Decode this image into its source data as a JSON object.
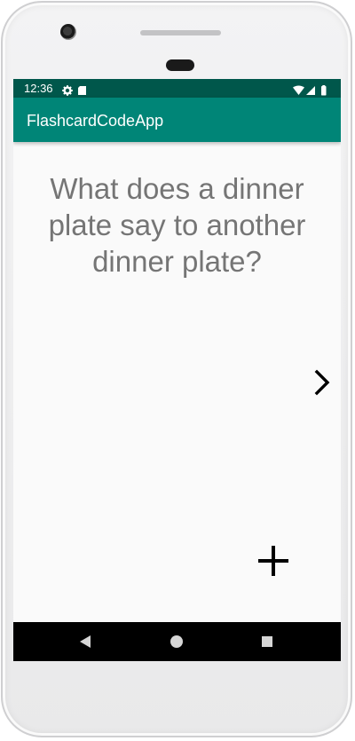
{
  "status_bar": {
    "time": "12:36",
    "left_icons": [
      "gear-icon",
      "sd-card-icon"
    ],
    "right_icons": [
      "wifi-icon",
      "signal-icon",
      "battery-icon"
    ],
    "color": "#00574b"
  },
  "app_bar": {
    "title": "FlashcardCodeApp",
    "color": "#008577"
  },
  "card": {
    "question": "What does a dinner plate say to another dinner plate?",
    "text_color": "#757575"
  },
  "actions": {
    "next_icon": "chevron-right-icon",
    "add_icon": "plus-icon"
  },
  "nav_bar": {
    "icons": [
      "back-triangle-icon",
      "home-circle-icon",
      "recents-square-icon"
    ]
  }
}
